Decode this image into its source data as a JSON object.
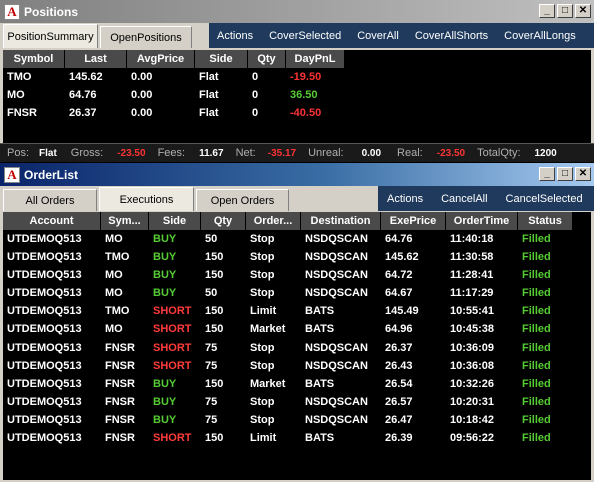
{
  "positions_window": {
    "title": "Positions",
    "tabs": [
      "PositionSummary",
      "OpenPositions"
    ],
    "actions": [
      "Actions",
      "CoverSelected",
      "CoverAll",
      "CoverAllShorts",
      "CoverAllLongs"
    ],
    "columns": [
      "Symbol",
      "Last",
      "AvgPrice",
      "Side",
      "Qty",
      "DayPnL"
    ],
    "rows": [
      {
        "symbol": "TMO",
        "last": "145.62",
        "avg_price": "0.00",
        "side": "Flat",
        "qty": "0",
        "day_pnl": "-19.50"
      },
      {
        "symbol": "MO",
        "last": "64.76",
        "avg_price": "0.00",
        "side": "Flat",
        "qty": "0",
        "day_pnl": "36.50"
      },
      {
        "symbol": "FNSR",
        "last": "26.37",
        "avg_price": "0.00",
        "side": "Flat",
        "qty": "0",
        "day_pnl": "-40.50"
      }
    ],
    "status": {
      "pos_label": "Pos:",
      "pos_value": "Flat",
      "gross_label": "Gross:",
      "gross_value": "-23.50",
      "fees_label": "Fees:",
      "fees_value": "11.67",
      "net_label": "Net:",
      "net_value": "-35.17",
      "unreal_label": "Unreal:",
      "unreal_value": "0.00",
      "real_label": "Real:",
      "real_value": "-23.50",
      "totalqty_label": "TotalQty:",
      "totalqty_value": "1200"
    }
  },
  "orders_window": {
    "title": "OrderList",
    "tabs": [
      "All Orders",
      "Executions",
      "Open Orders"
    ],
    "actions": [
      "Actions",
      "CancelAll",
      "CancelSelected"
    ],
    "columns": [
      "Account",
      "Sym...",
      "Side",
      "Qty",
      "Order...",
      "Destination",
      "ExePrice",
      "OrderTime",
      "Status"
    ],
    "rows": [
      {
        "account": "UTDEMOQ513",
        "symbol": "MO",
        "side": "BUY",
        "qty": "50",
        "order_type": "Stop",
        "destination": "NSDQSCAN",
        "exe_price": "64.76",
        "order_time": "11:40:18",
        "status": "Filled"
      },
      {
        "account": "UTDEMOQ513",
        "symbol": "TMO",
        "side": "BUY",
        "qty": "150",
        "order_type": "Stop",
        "destination": "NSDQSCAN",
        "exe_price": "145.62",
        "order_time": "11:30:58",
        "status": "Filled"
      },
      {
        "account": "UTDEMOQ513",
        "symbol": "MO",
        "side": "BUY",
        "qty": "150",
        "order_type": "Stop",
        "destination": "NSDQSCAN",
        "exe_price": "64.72",
        "order_time": "11:28:41",
        "status": "Filled"
      },
      {
        "account": "UTDEMOQ513",
        "symbol": "MO",
        "side": "BUY",
        "qty": "50",
        "order_type": "Stop",
        "destination": "NSDQSCAN",
        "exe_price": "64.67",
        "order_time": "11:17:29",
        "status": "Filled"
      },
      {
        "account": "UTDEMOQ513",
        "symbol": "TMO",
        "side": "SHORT",
        "qty": "150",
        "order_type": "Limit",
        "destination": "BATS",
        "exe_price": "145.49",
        "order_time": "10:55:41",
        "status": "Filled"
      },
      {
        "account": "UTDEMOQ513",
        "symbol": "MO",
        "side": "SHORT",
        "qty": "150",
        "order_type": "Market",
        "destination": "BATS",
        "exe_price": "64.96",
        "order_time": "10:45:38",
        "status": "Filled"
      },
      {
        "account": "UTDEMOQ513",
        "symbol": "FNSR",
        "side": "SHORT",
        "qty": "75",
        "order_type": "Stop",
        "destination": "NSDQSCAN",
        "exe_price": "26.37",
        "order_time": "10:36:09",
        "status": "Filled"
      },
      {
        "account": "UTDEMOQ513",
        "symbol": "FNSR",
        "side": "SHORT",
        "qty": "75",
        "order_type": "Stop",
        "destination": "NSDQSCAN",
        "exe_price": "26.43",
        "order_time": "10:36:08",
        "status": "Filled"
      },
      {
        "account": "UTDEMOQ513",
        "symbol": "FNSR",
        "side": "BUY",
        "qty": "150",
        "order_type": "Market",
        "destination": "BATS",
        "exe_price": "26.54",
        "order_time": "10:32:26",
        "status": "Filled"
      },
      {
        "account": "UTDEMOQ513",
        "symbol": "FNSR",
        "side": "BUY",
        "qty": "75",
        "order_type": "Stop",
        "destination": "NSDQSCAN",
        "exe_price": "26.57",
        "order_time": "10:20:31",
        "status": "Filled"
      },
      {
        "account": "UTDEMOQ513",
        "symbol": "FNSR",
        "side": "BUY",
        "qty": "75",
        "order_type": "Stop",
        "destination": "NSDQSCAN",
        "exe_price": "26.47",
        "order_time": "10:18:42",
        "status": "Filled"
      },
      {
        "account": "UTDEMOQ513",
        "symbol": "FNSR",
        "side": "SHORT",
        "qty": "150",
        "order_type": "Limit",
        "destination": "BATS",
        "exe_price": "26.39",
        "order_time": "09:56:22",
        "status": "Filled"
      }
    ]
  },
  "colors": {
    "buy": "#55cc33",
    "short": "#ff3b3b",
    "filled": "#55cc33",
    "loss": "#ff3333",
    "gain": "#55cc33"
  },
  "icons": {
    "app": "app-logo-icon",
    "minimize": "minimize-icon",
    "maximize": "maximize-icon",
    "close": "close-icon"
  }
}
